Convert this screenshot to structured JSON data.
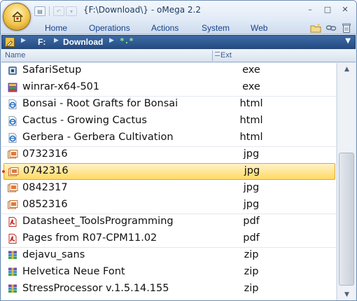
{
  "window": {
    "title_path": "{F:\\Download\\}",
    "title_sep": " - ",
    "app_name": "oMega 2.2",
    "controls": {
      "minimize": "–",
      "maximize": "□",
      "close": "✕"
    }
  },
  "ribbon": {
    "tabs": [
      "Home",
      "Operations",
      "Actions",
      "System",
      "Web"
    ]
  },
  "breadcrumb": {
    "drive": "F:",
    "folder": "Download",
    "filter": "*.*"
  },
  "columns": {
    "name": "Name",
    "ext": "Ext"
  },
  "files": [
    {
      "name": "SafariSetup",
      "ext": "exe",
      "icon": "installer-icon"
    },
    {
      "name": "winrar-x64-501",
      "ext": "exe",
      "icon": "winrar-installer-icon"
    },
    {
      "name": "Bonsai - Root Grafts for Bonsai",
      "ext": "html",
      "icon": "html-ie-icon"
    },
    {
      "name": "Cactus - Growing Cactus",
      "ext": "html",
      "icon": "html-ie-icon"
    },
    {
      "name": "Gerbera - Gerbera Cultivation",
      "ext": "html",
      "icon": "html-ie-icon"
    },
    {
      "name": "0732316",
      "ext": "jpg",
      "icon": "image-icon"
    },
    {
      "name": "0742316",
      "ext": "jpg",
      "icon": "image-icon",
      "selected": true
    },
    {
      "name": "0842317",
      "ext": "jpg",
      "icon": "image-icon"
    },
    {
      "name": "0852316",
      "ext": "jpg",
      "icon": "image-icon"
    },
    {
      "name": "Datasheet_ToolsProgramming",
      "ext": "pdf",
      "icon": "pdf-icon"
    },
    {
      "name": "Pages from R07-CPM11.02",
      "ext": "pdf",
      "icon": "pdf-icon"
    },
    {
      "name": "dejavu_sans",
      "ext": "zip",
      "icon": "archive-icon"
    },
    {
      "name": "Helvetica Neue Font",
      "ext": "zip",
      "icon": "archive-icon"
    },
    {
      "name": "StressProcessor v.1.5.14.155",
      "ext": "zip",
      "icon": "archive-icon"
    }
  ],
  "colors": {
    "title_text": "#1e3a5f",
    "ribbon_tab_text": "#15428b",
    "breadcrumb_bg": "#254d85",
    "selection_bg": "#ffd966",
    "selection_border": "#e2a82a"
  }
}
